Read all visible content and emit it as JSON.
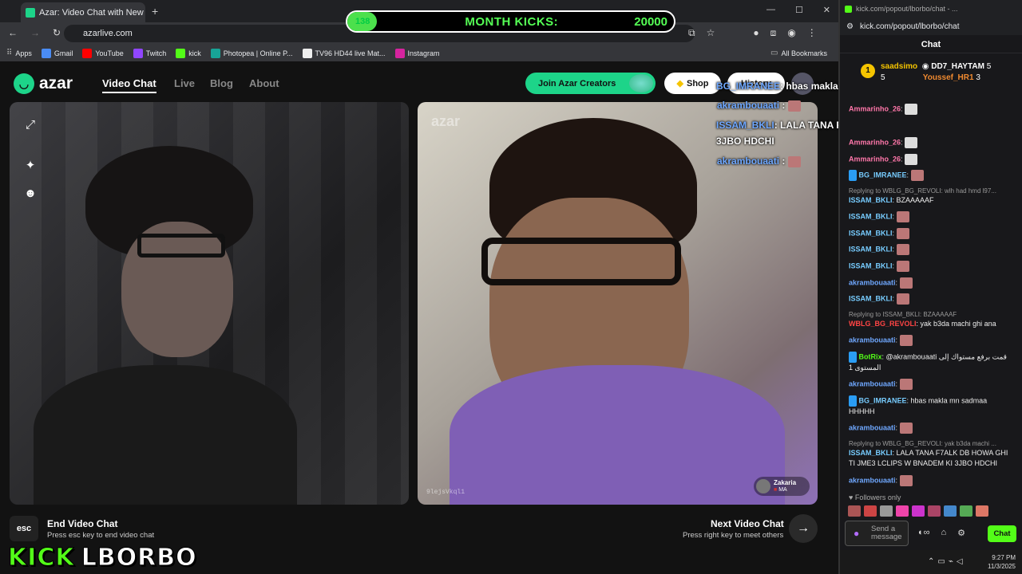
{
  "browser": {
    "tab_title": "Azar: Video Chat with New",
    "url": "azarlive.com",
    "bookmarks": [
      "Apps",
      "Gmail",
      "YouTube",
      "Twitch",
      "kick",
      "Photopea | Online P...",
      "TV96 HD44 live Mat...",
      "Instagram"
    ],
    "all_bookmarks": "All Bookmarks"
  },
  "azar": {
    "logo": "azar",
    "nav": [
      "Video Chat",
      "Live",
      "Blog",
      "About"
    ],
    "creators": "Join Azar Creators",
    "shop": "Shop",
    "history": "History",
    "watermark": "azar",
    "video_id": "9lejsVkql1",
    "peer_name": "Zakaria",
    "peer_country": "MA",
    "end_title": "End Video Chat",
    "end_sub": "Press esc key to end video chat",
    "esc": "esc",
    "next_title": "Next Video Chat",
    "next_sub": "Press right key to meet others"
  },
  "overlay": {
    "m1_name": "BG_IMRANEE",
    "m1_text": ": hbas makla mn sadmaa HHHHH",
    "m2_name": "akrambouaati",
    "m3_name": "ISSAM_BKLI",
    "m3_text": ": LALA TANA F7ALK DB HOWA GHI TI JME3 LCLIPS W BNADEM KI",
    "m3_cont": "3JBO HDCHI",
    "m4_name": "akrambouaati"
  },
  "month_kicks": {
    "current": "138",
    "title": "MONTH KICKS:",
    "goal": "20000",
    "progress": 0.007
  },
  "brand": {
    "kick": "KICK",
    "name": "LBORBO"
  },
  "kick": {
    "title": "kick.com/popout/lborbo/chat - ...",
    "url": "kick.com/popout/lborbo/chat",
    "header": "Chat",
    "top_rank": "1",
    "top1": "saadsimo",
    "top1_n": "5",
    "top2": "DD7_HAYTAM",
    "top2_n": "5",
    "top3": "Youssef_HR1",
    "top3_n": "3",
    "followers": "Followers only",
    "input_placeholder": "Send a message",
    "chat_btn": "Chat",
    "time": "9:27 PM",
    "date": "11/3/2025",
    "msgs": [
      {
        "user": "Ammarinho_26",
        "text": ""
      },
      {
        "user": "Ammarinho_26",
        "text": ""
      },
      {
        "user": "Ammarinho_26",
        "text": ""
      },
      {
        "user": "BG_IMRANEE",
        "text": ""
      },
      {
        "reply": "Replying to WBLG_BG_REVOLI: wlh had hmd l97..."
      },
      {
        "user": "ISSAM_BKLI",
        "text": "BZAAAAAF"
      },
      {
        "user": "ISSAM_BKLI",
        "text": ""
      },
      {
        "user": "ISSAM_BKLI",
        "text": ""
      },
      {
        "user": "ISSAM_BKLI",
        "text": ""
      },
      {
        "user": "ISSAM_BKLI",
        "text": ""
      },
      {
        "user": "akrambouaati",
        "text": ""
      },
      {
        "user": "ISSAM_BKLI",
        "text": ""
      },
      {
        "reply": "Replying to ISSAM_BKLI: BZAAAAAF"
      },
      {
        "user": "WBLG_BG_REVOLI",
        "text": "yak b3da machi ghi ana"
      },
      {
        "user": "akrambouaati",
        "text": ""
      },
      {
        "user": "BotRix",
        "text": "@akrambouaati قمت برفع مستواك إلى المستوى 1"
      },
      {
        "user": "akrambouaati",
        "text": ""
      },
      {
        "user": "BG_IMRANEE",
        "text": "hbas makla mn sadmaa HHHHH"
      },
      {
        "user": "akrambouaati",
        "text": ""
      },
      {
        "reply": "Replying to WBLG_BG_REVOLI: yak b3da machi ..."
      },
      {
        "user": "ISSAM_BKLI",
        "text": "LALA TANA F7ALK DB HOWA GHI TI JME3 LCLIPS W BNADEM KI 3JBO HDCHI"
      },
      {
        "user": "akrambouaati",
        "text": ""
      }
    ]
  },
  "colors": {
    "kick_green": "#53fc18",
    "azar_green": "#1dd489"
  }
}
